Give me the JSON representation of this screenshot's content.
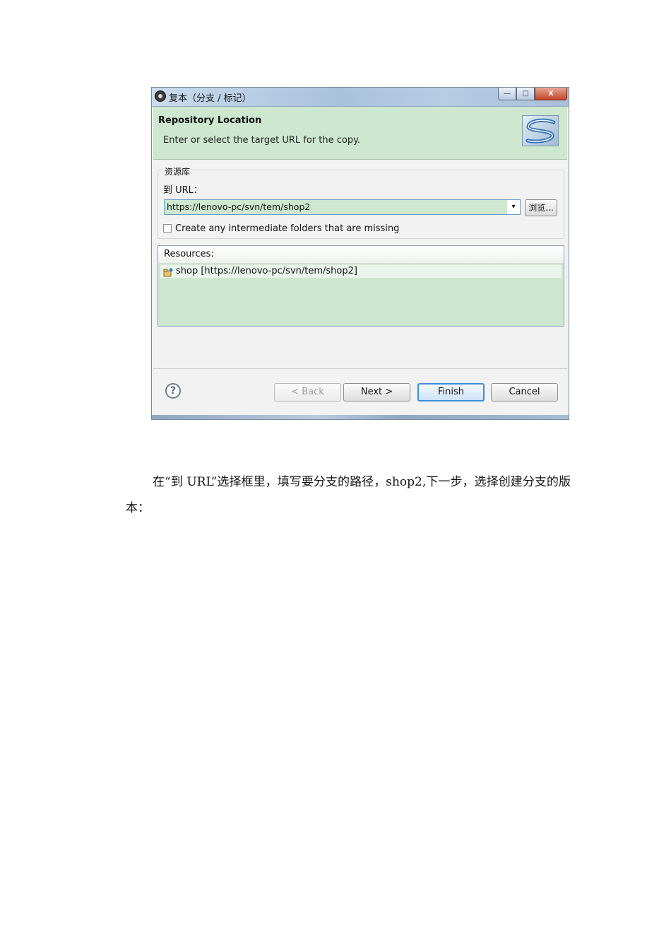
{
  "dialog": {
    "title": "复本（分支 / 标记）",
    "window_buttons": {
      "minimize": "—",
      "maximize": "□",
      "close": "X"
    },
    "header": {
      "title": "Repository Location",
      "description": "Enter or select the target URL for the copy."
    },
    "group": {
      "legend": "资源库",
      "url_label": "到 URL：",
      "url_value": "https://lenovo-pc/svn/tem/shop2",
      "dropdown_glyph": "▾",
      "browse_label": "浏览...",
      "checkbox_label": "Create any intermediate folders that are missing",
      "checkbox_checked": false
    },
    "resources": {
      "header": "Resources:",
      "items": [
        "shop [https://lenovo-pc/svn/tem/shop2]"
      ]
    },
    "footer": {
      "help": "?",
      "back": "< Back",
      "next": "Next >",
      "finish": "Finish",
      "cancel": "Cancel"
    }
  },
  "body_text": "在“到 URL”选择框里，填写要分支的路径，shop2,下一步，选择创建分支的版本："
}
